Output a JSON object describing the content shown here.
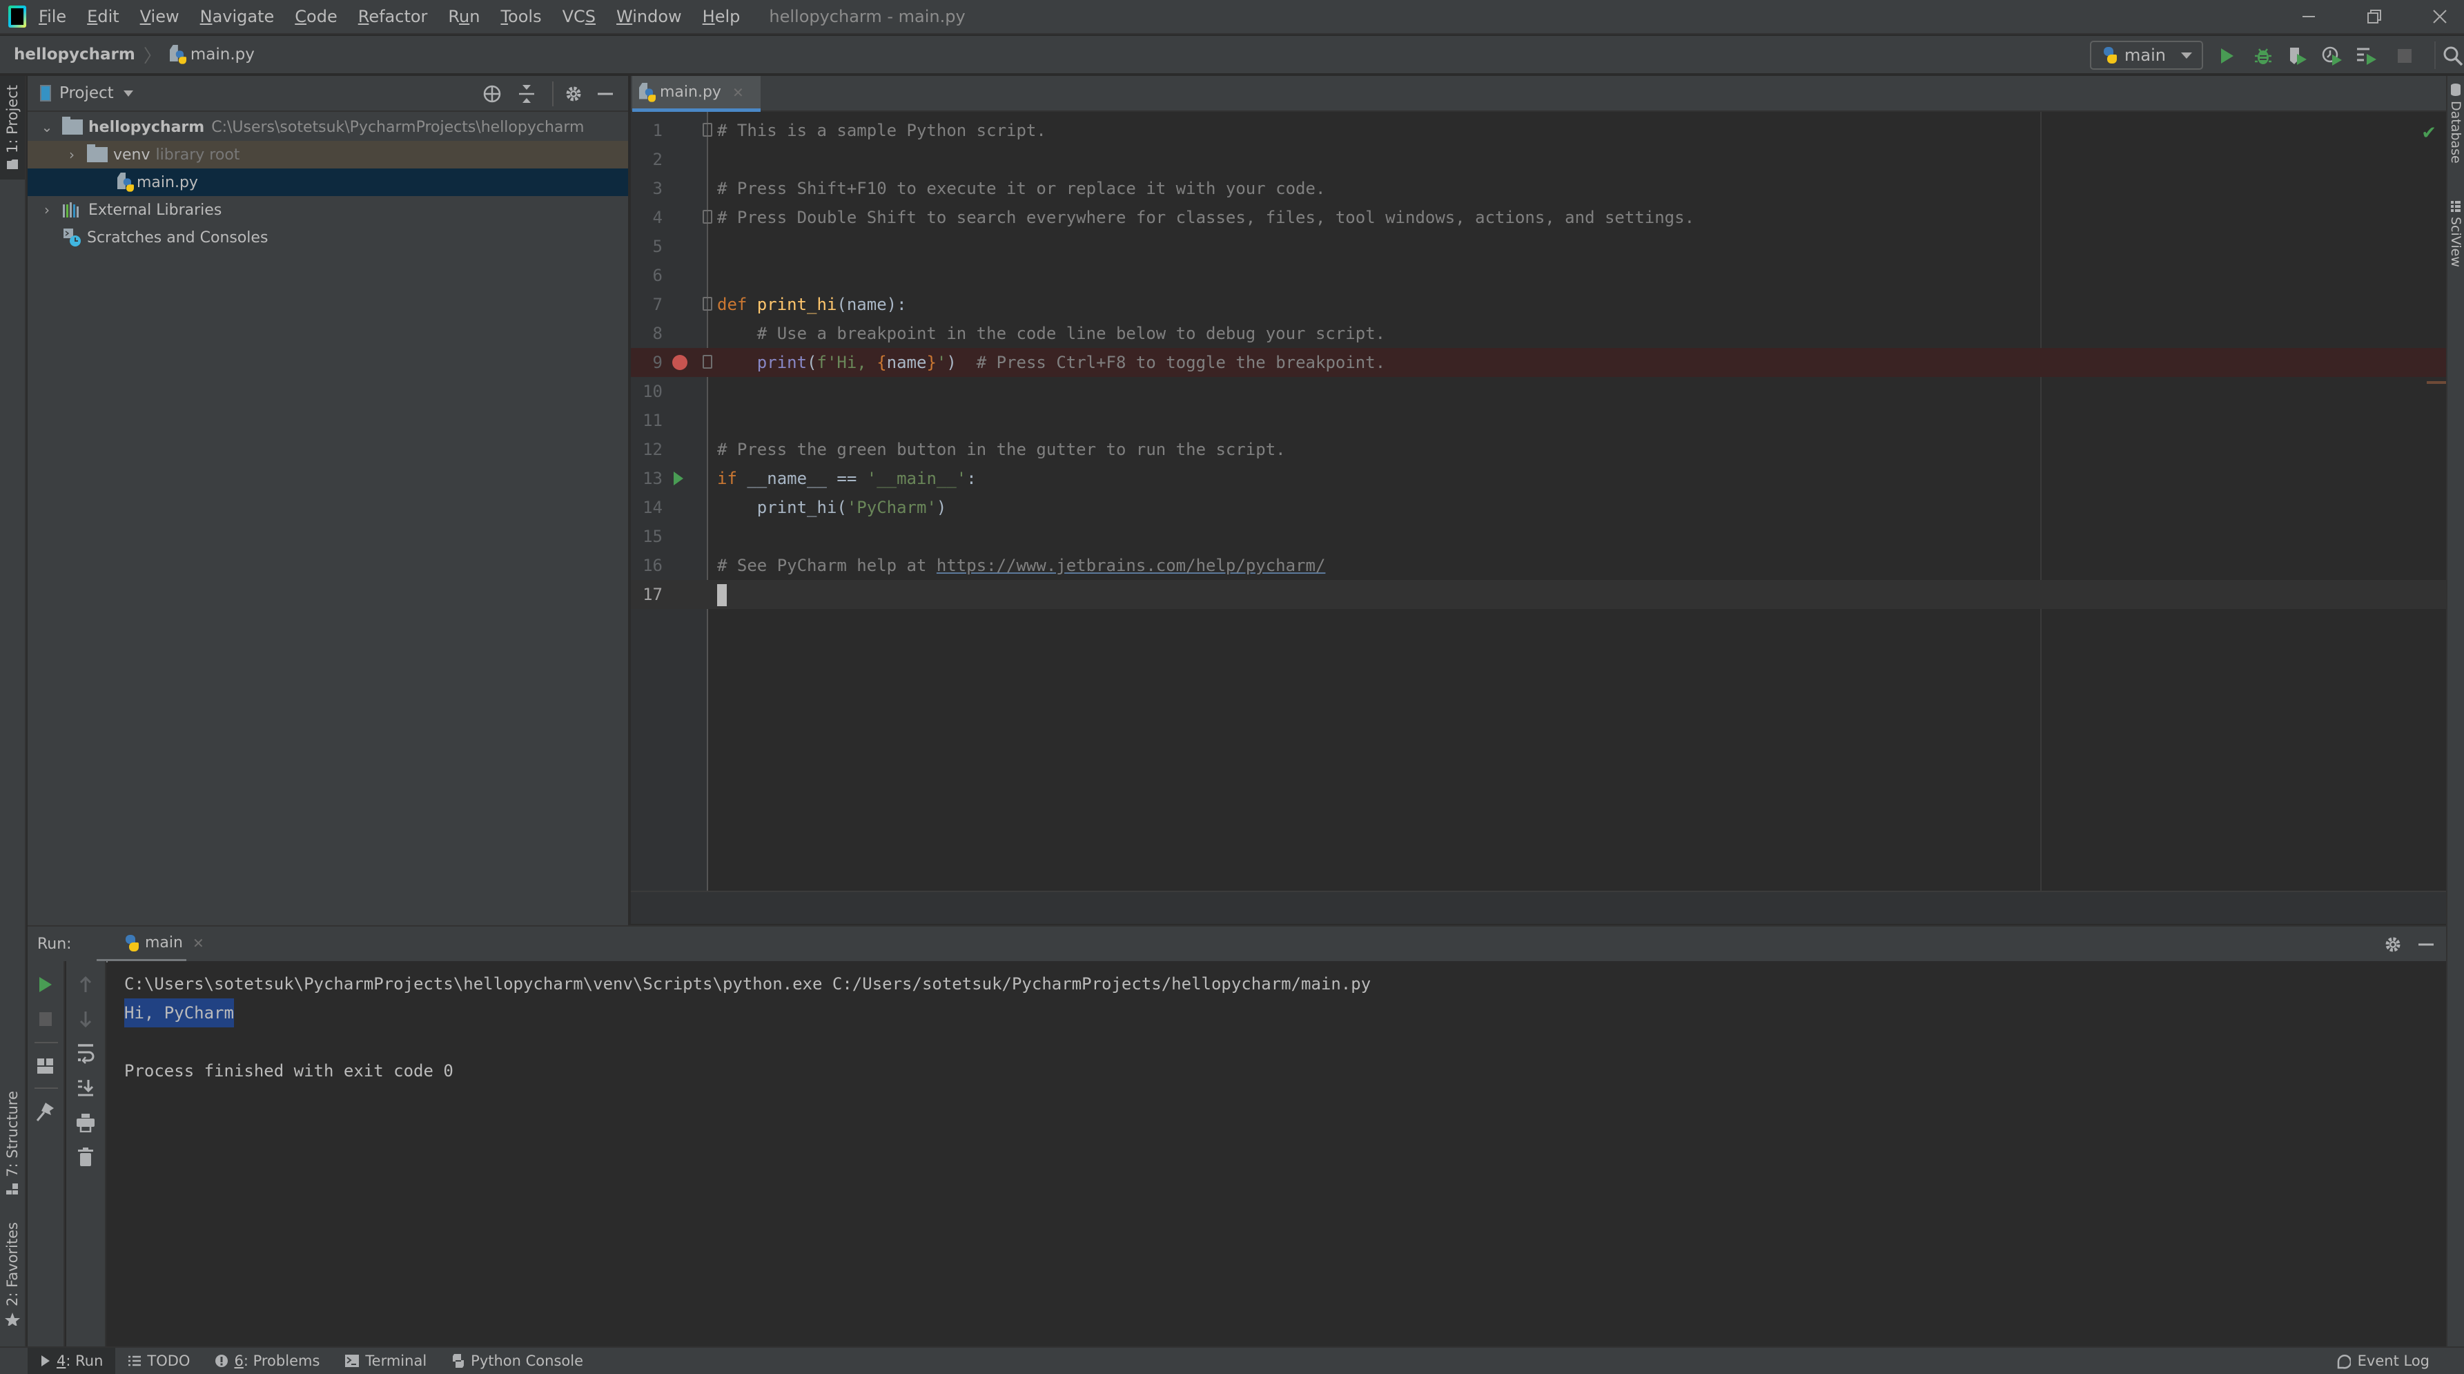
{
  "window": {
    "title": "hellopycharm - main.py",
    "controls": [
      "minimize",
      "restore",
      "close"
    ]
  },
  "menu": {
    "items": [
      {
        "label": "File",
        "mnemonic": "F",
        "rest": "ile"
      },
      {
        "label": "Edit",
        "mnemonic": "E",
        "rest": "dit"
      },
      {
        "label": "View",
        "mnemonic": "V",
        "rest": "iew"
      },
      {
        "label": "Navigate",
        "mnemonic": "N",
        "rest": "avigate"
      },
      {
        "label": "Code",
        "mnemonic": "C",
        "rest": "ode"
      },
      {
        "label": "Refactor",
        "mnemonic": "R",
        "rest": "efactor"
      },
      {
        "label": "Run",
        "mnemonic": "",
        "pre": "R",
        "mid": "u",
        "post": "n"
      },
      {
        "label": "Tools",
        "mnemonic": "T",
        "rest": "ools"
      },
      {
        "label": "VCS",
        "pre": "VC",
        "mid": "S",
        "post": ""
      },
      {
        "label": "Window",
        "mnemonic": "W",
        "rest": "indow"
      },
      {
        "label": "Help",
        "mnemonic": "H",
        "rest": "elp"
      }
    ]
  },
  "navbar": {
    "project": "hellopycharm",
    "file": "main.py",
    "run_config": "main",
    "tools": [
      "run-icon",
      "debug-icon",
      "coverage-icon",
      "profile-icon",
      "concurrency-icon",
      "stop-icon",
      "search-icon"
    ]
  },
  "stripes": {
    "left_top": "1: Project",
    "left_structure": "7: Structure",
    "left_favorites": "2: Favorites",
    "right_database": "Database",
    "right_sciview": "SciView"
  },
  "project_panel": {
    "title": "Project",
    "tree": [
      {
        "name": "hellopycharm",
        "hint": "C:\\Users\\sotetsuk\\PycharmProjects\\hellopycharm",
        "expanded": true,
        "type": "folder"
      },
      {
        "name": "venv",
        "hint": "library root",
        "expanded": false,
        "type": "folder"
      },
      {
        "name": "main.py",
        "type": "python-file",
        "selected": true
      },
      {
        "name": "External Libraries",
        "expanded": false,
        "type": "libraries"
      },
      {
        "name": "Scratches and Consoles",
        "type": "scratches"
      }
    ]
  },
  "editor": {
    "tab": "main.py",
    "lines": [
      {
        "n": "1",
        "tokens": [
          [
            "c-com",
            "# This is a sample Python script."
          ]
        ]
      },
      {
        "n": "2",
        "tokens": []
      },
      {
        "n": "3",
        "tokens": [
          [
            "c-com",
            "# Press Shift+F10 to execute it or replace it with your code."
          ]
        ]
      },
      {
        "n": "4",
        "tokens": [
          [
            "c-com",
            "# Press Double Shift to search everywhere for classes, files, tool windows, actions, and settings."
          ]
        ]
      },
      {
        "n": "5",
        "tokens": []
      },
      {
        "n": "6",
        "tokens": []
      },
      {
        "n": "7",
        "tokens": [
          [
            "c-kw",
            "def "
          ],
          [
            "c-fn",
            "print_hi"
          ],
          [
            "c-txt",
            "(name):"
          ]
        ]
      },
      {
        "n": "8",
        "tokens": [
          [
            "c-com",
            "    # Use a breakpoint in the code line below to debug your script."
          ]
        ]
      },
      {
        "n": "9",
        "tokens": [
          [
            "c-txt",
            "    "
          ],
          [
            "c-bi",
            "print"
          ],
          [
            "c-txt",
            "("
          ],
          [
            "c-str",
            "f'Hi, "
          ],
          [
            "c-kw",
            "{"
          ],
          [
            "c-txt",
            "name"
          ],
          [
            "c-kw",
            "}"
          ],
          [
            "c-str",
            "'"
          ],
          [
            "c-txt",
            ")  "
          ],
          [
            "c-com",
            "# Press Ctrl+F8 to toggle the breakpoint."
          ]
        ]
      },
      {
        "n": "10",
        "tokens": []
      },
      {
        "n": "11",
        "tokens": []
      },
      {
        "n": "12",
        "tokens": [
          [
            "c-com",
            "# Press the green button in the gutter to run the script."
          ]
        ]
      },
      {
        "n": "13",
        "tokens": [
          [
            "c-kw",
            "if "
          ],
          [
            "c-txt",
            "__name__ == "
          ],
          [
            "c-str",
            "'__main__'"
          ],
          [
            "c-txt",
            ":"
          ]
        ]
      },
      {
        "n": "14",
        "tokens": [
          [
            "c-txt",
            "    print_hi("
          ],
          [
            "c-str",
            "'PyCharm'"
          ],
          [
            "c-txt",
            ")"
          ]
        ]
      },
      {
        "n": "15",
        "tokens": []
      },
      {
        "n": "16",
        "tokens": [
          [
            "c-com",
            "# See PyCharm help at "
          ],
          [
            "c-link",
            "https://www.jetbrains.com/help/pycharm/"
          ]
        ]
      },
      {
        "n": "17",
        "tokens": []
      }
    ],
    "breakpoint_line": "9",
    "run_gutter_line": "13",
    "current_line": "17",
    "fold_lines": [
      "1",
      "4",
      "7",
      "9"
    ]
  },
  "run_panel": {
    "label": "Run:",
    "tab": "main",
    "console": [
      "C:\\Users\\sotetsuk\\PycharmProjects\\hellopycharm\\venv\\Scripts\\python.exe C:/Users/sotetsuk/PycharmProjects/hellopycharm/main.py",
      "Hi, PyCharm",
      "",
      "Process finished with exit code 0"
    ]
  },
  "bottom_bar": {
    "tabs": [
      {
        "num": "4",
        "label": ": Run",
        "icon": "run-icon",
        "active": true
      },
      {
        "num": "",
        "label": "TODO",
        "icon": "todo-list-icon"
      },
      {
        "num": "6",
        "label": ": Problems",
        "icon": "problems-icon"
      },
      {
        "num": "",
        "label": "Terminal",
        "icon": "terminal-icon"
      },
      {
        "num": "",
        "label": "Python Console",
        "icon": "python-console-icon"
      }
    ],
    "event_log": "Event Log"
  },
  "colors": {
    "accent": "#4a88c7",
    "run_green": "#499c54",
    "breakpoint_red": "#c75450",
    "selection": "#214283"
  }
}
